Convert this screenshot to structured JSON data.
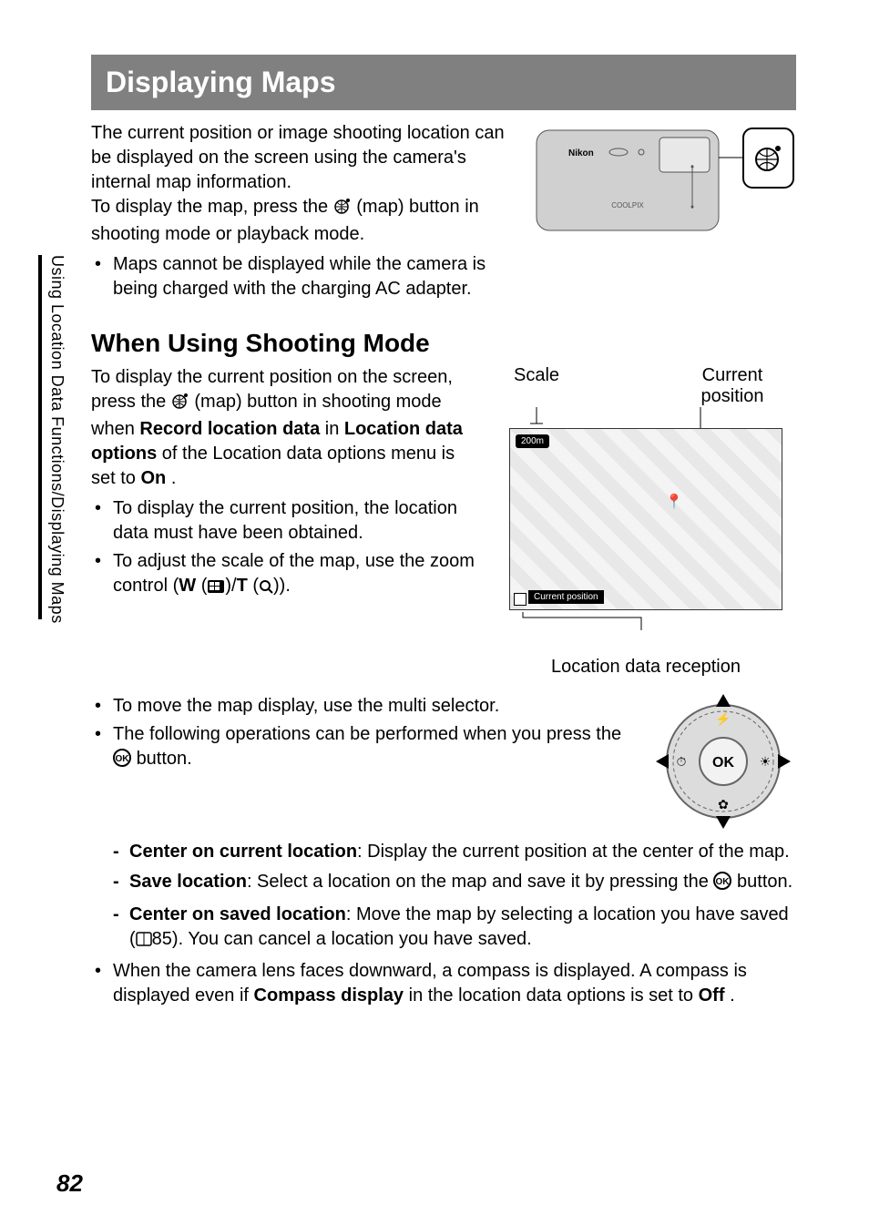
{
  "sideTab": "Using Location Data Functions/Displaying Maps",
  "h1": "Displaying Maps",
  "intro": {
    "p1": "The current position or image shooting location can be displayed on the screen using the camera's internal map information.",
    "p2a": "To display the map, press the ",
    "p2b": " (map) button in shooting mode or playback mode.",
    "bullet1": "Maps cannot be displayed while the camera is being charged with the charging AC adapter."
  },
  "camera": {
    "brand": "Nikon",
    "model": "COOLPIX"
  },
  "h2": "When Using Shooting Mode",
  "shoot": {
    "p_a": "To display the current position on the screen, press the ",
    "p_b": " (map) button in shooting mode when ",
    "p_c": " in ",
    "p_d": " of the Location data options menu is set to ",
    "p_e": ".",
    "rec_loc": "Record location data",
    "loc_opts": "Location data options",
    "on": "On",
    "b1": "To display the current position, the location data must have been obtained.",
    "b2a": "To adjust the scale of the map, use the zoom control (",
    "b2b": " (",
    "b2c": ")/",
    "b2d": " (",
    "b2e": ")).",
    "W": "W",
    "T": "T"
  },
  "mapLabels": {
    "scale": "Scale",
    "curpos": "Current position",
    "scaleBadge": "200m",
    "curposBadge": "Current position",
    "caption": "Location data reception"
  },
  "sel": {
    "b3": "To move the map display, use the multi selector.",
    "b4a": "The following operations can be performed when you press the ",
    "b4b": " button.",
    "d1t": "Center on current location",
    "d1b": ": Display the current position at the center of the map.",
    "d2t": "Save location",
    "d2b": ": Select a location on the map and save it by pressing the ",
    "d2c": " button.",
    "d3t": "Center on saved location",
    "d3b": ": Move the map by selecting a location you have saved (",
    "d3c": "85). You can cancel a location you have saved.",
    "b5a": "When the camera lens faces downward, a compass is displayed. A compass is displayed even if ",
    "b5b": " in the location data options is set to ",
    "b5c": ".",
    "compass": "Compass display",
    "off": "Off",
    "ok": "OK"
  },
  "pageNumber": "82"
}
